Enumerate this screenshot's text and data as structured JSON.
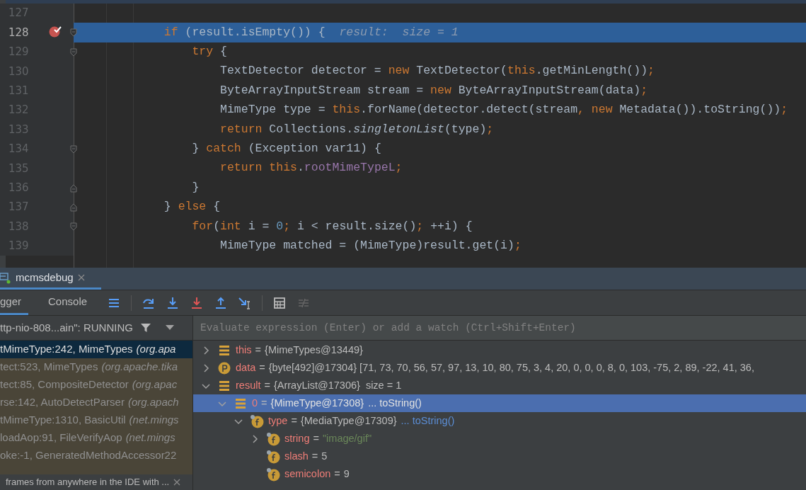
{
  "editor": {
    "lines": [
      {
        "number": "127",
        "selected": false,
        "breakpoint": false,
        "fold_start": false,
        "fold_end": false
      },
      {
        "number": "128",
        "selected": true,
        "breakpoint": true,
        "fold_start": true,
        "fold_end": false,
        "tokens": [
          {
            "kind": "kw",
            "text": "            if "
          },
          {
            "kind": "plain",
            "text": "(result.isEmpty()) {  "
          },
          {
            "kind": "hint",
            "text": "result:  size = 1"
          }
        ]
      },
      {
        "number": "129",
        "selected": false,
        "breakpoint": false,
        "fold_start": true,
        "fold_end": false,
        "tokens": [
          {
            "kind": "kw",
            "text": "                try "
          },
          {
            "kind": "plain",
            "text": "{"
          }
        ]
      },
      {
        "number": "130",
        "selected": false,
        "breakpoint": false,
        "fold_start": false,
        "fold_end": false,
        "tokens": [
          {
            "kind": "plain",
            "text": "                    TextDetector detector = "
          },
          {
            "kind": "kw",
            "text": "new "
          },
          {
            "kind": "plain",
            "text": "TextDetector("
          },
          {
            "kind": "kw",
            "text": "this"
          },
          {
            "kind": "plain",
            "text": ".getMinLength())"
          },
          {
            "kind": "kw",
            "text": ";"
          }
        ]
      },
      {
        "number": "131",
        "selected": false,
        "breakpoint": false,
        "fold_start": false,
        "fold_end": false,
        "tokens": [
          {
            "kind": "plain",
            "text": "                    ByteArrayInputStream stream = "
          },
          {
            "kind": "kw",
            "text": "new "
          },
          {
            "kind": "plain",
            "text": "ByteArrayInputStream(data)"
          },
          {
            "kind": "kw",
            "text": ";"
          }
        ]
      },
      {
        "number": "132",
        "selected": false,
        "breakpoint": false,
        "fold_start": false,
        "fold_end": false,
        "tokens": [
          {
            "kind": "plain",
            "text": "                    MimeType type = "
          },
          {
            "kind": "kw",
            "text": "this"
          },
          {
            "kind": "plain",
            "text": ".forName(detector.detect(stream"
          },
          {
            "kind": "kw",
            "text": ", new "
          },
          {
            "kind": "plain",
            "text": "Metadata()).toString())"
          },
          {
            "kind": "kw",
            "text": ";"
          }
        ]
      },
      {
        "number": "133",
        "selected": false,
        "breakpoint": false,
        "fold_start": false,
        "fold_end": false,
        "tokens": [
          {
            "kind": "kw",
            "text": "                    return "
          },
          {
            "kind": "plain",
            "text": "Collections."
          },
          {
            "kind": "italic",
            "text": "singletonList"
          },
          {
            "kind": "plain",
            "text": "(type)"
          },
          {
            "kind": "kw",
            "text": ";"
          }
        ]
      },
      {
        "number": "134",
        "selected": false,
        "breakpoint": false,
        "fold_start": true,
        "fold_end": false,
        "tokens": [
          {
            "kind": "plain",
            "text": "                } "
          },
          {
            "kind": "kw",
            "text": "catch "
          },
          {
            "kind": "plain",
            "text": "(Exception var11) {"
          }
        ]
      },
      {
        "number": "135",
        "selected": false,
        "breakpoint": false,
        "fold_start": false,
        "fold_end": false,
        "tokens": [
          {
            "kind": "kw",
            "text": "                    return this"
          },
          {
            "kind": "plain",
            "text": "."
          },
          {
            "kind": "field",
            "text": "rootMimeTypeL"
          },
          {
            "kind": "kw",
            "text": ";"
          }
        ]
      },
      {
        "number": "136",
        "selected": false,
        "breakpoint": false,
        "fold_start": false,
        "fold_end": true,
        "tokens": [
          {
            "kind": "plain",
            "text": "                }"
          }
        ]
      },
      {
        "number": "137",
        "selected": false,
        "breakpoint": false,
        "fold_start": false,
        "fold_end": true,
        "tokens": [
          {
            "kind": "plain",
            "text": "            } "
          },
          {
            "kind": "kw",
            "text": "else "
          },
          {
            "kind": "plain",
            "text": "{"
          }
        ]
      },
      {
        "number": "138",
        "selected": false,
        "breakpoint": false,
        "fold_start": true,
        "fold_end": false,
        "tokens": [
          {
            "kind": "kw",
            "text": "                for"
          },
          {
            "kind": "plain",
            "text": "("
          },
          {
            "kind": "kw",
            "text": "int "
          },
          {
            "kind": "plain",
            "text": "i = "
          },
          {
            "kind": "num",
            "text": "0"
          },
          {
            "kind": "kw",
            "text": "; "
          },
          {
            "kind": "plain",
            "text": "i < result.size()"
          },
          {
            "kind": "kw",
            "text": "; "
          },
          {
            "kind": "plain",
            "text": "++i) {"
          }
        ]
      },
      {
        "number": "139",
        "selected": false,
        "breakpoint": false,
        "fold_start": false,
        "fold_end": false,
        "tokens": [
          {
            "kind": "plain",
            "text": "                    MimeType matched = (MimeType)result.get(i)"
          },
          {
            "kind": "kw",
            "text": ";"
          }
        ]
      }
    ]
  },
  "debug_panel": {
    "session_tab": {
      "title": "mcmsdebug",
      "selected": true
    },
    "tabs": [
      {
        "label": "gger",
        "selected": true
      },
      {
        "label": "Console",
        "selected": false
      }
    ],
    "thread": {
      "label": "ttp-nio-808...ain\": RUNNING"
    },
    "frames": [
      {
        "method": "tMimeType:242, MimeTypes",
        "package": "(org.apa",
        "selected": true,
        "library": false
      },
      {
        "method": "tect:523, MimeTypes",
        "package": "(org.apache.tika",
        "selected": false,
        "library": true
      },
      {
        "method": "tect:85, CompositeDetector",
        "package": "(org.apac",
        "selected": false,
        "library": true
      },
      {
        "method": "rse:142, AutoDetectParser",
        "package": "(org.apach",
        "selected": false,
        "library": true
      },
      {
        "method": "tMimeType:1310, BasicUtil",
        "package": "(net.mings",
        "selected": false,
        "library": true
      },
      {
        "method": "loadAop:91, FileVerifyAop",
        "package": "(net.mings",
        "selected": false,
        "library": true
      },
      {
        "method": "oke:-1, GeneratedMethodAccessor22",
        "selected": false,
        "library": true
      }
    ],
    "frames_hint": "frames from anywhere in the IDE with ...",
    "evaluate": {
      "placeholder": "Evaluate expression (Enter) or add a watch (Ctrl+Shift+Enter)"
    },
    "variables": [
      {
        "kind": "object",
        "name": "this",
        "sep": "=",
        "value": "{MimeTypes@13449}",
        "expanded": false,
        "selected": false
      },
      {
        "kind": "param",
        "name": "data",
        "sep": "=",
        "value": "{byte[492]@17304} [71, 73, 70, 56, 57, 97, 13, 10, 80, 75, 3, 4, 20, 0, 0, 0, 8, 0, 103, -75, 2, 89, -22, 41, 36,",
        "expanded": false,
        "selected": false
      },
      {
        "kind": "object",
        "name": "result",
        "sep": "=",
        "value": "{ArrayList@17306}",
        "extra": "size = 1",
        "expanded": true,
        "selected": false,
        "children": [
          {
            "kind": "object",
            "name": "0",
            "sep": "=",
            "value": "{MimeType@17308}",
            "link": "... toString()",
            "expanded": true,
            "selected": true,
            "children": [
              {
                "kind": "field",
                "name": "type",
                "sep": "=",
                "value": "{MediaType@17309}",
                "link": "... toString()",
                "expanded": true,
                "selected": false,
                "children": [
                  {
                    "kind": "field",
                    "name": "string",
                    "sep": "=",
                    "string": "\"image/gif\"",
                    "expanded": false,
                    "selected": false
                  },
                  {
                    "kind": "field",
                    "name": "slash",
                    "sep": "=",
                    "value": "5",
                    "selected": false
                  },
                  {
                    "kind": "field",
                    "name": "semicolon",
                    "sep": "=",
                    "value": "9",
                    "selected": false
                  }
                ]
              }
            ]
          }
        ]
      }
    ]
  }
}
